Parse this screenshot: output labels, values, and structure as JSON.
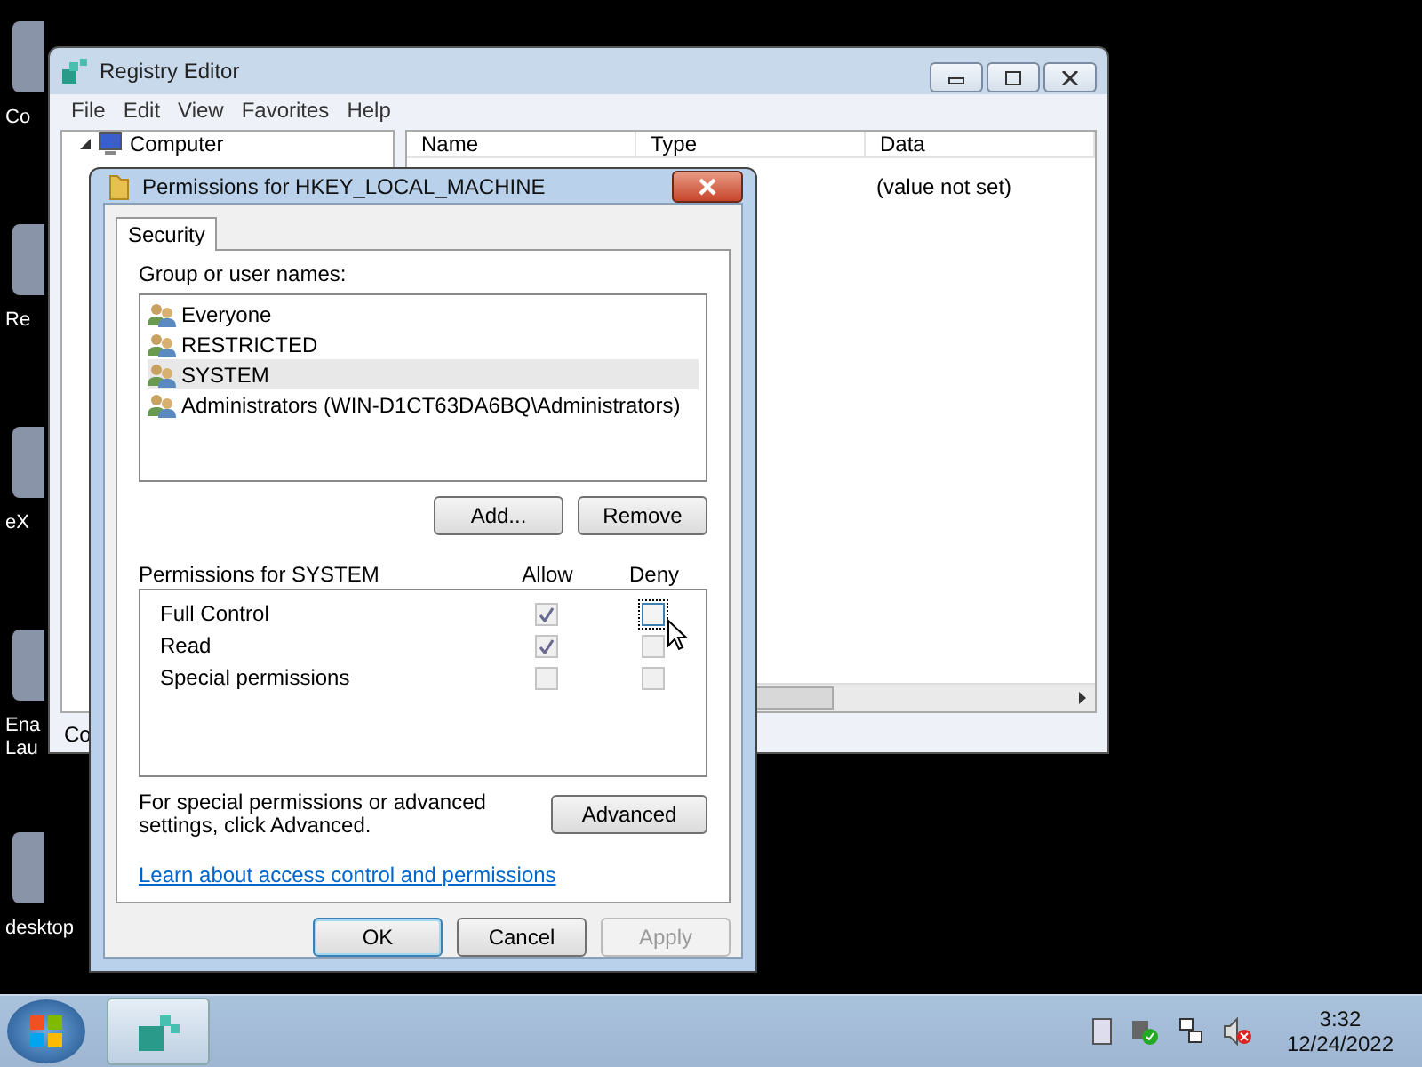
{
  "desktop_icons": [
    {
      "lines": [
        "Co"
      ]
    },
    {
      "lines": [
        "Re"
      ]
    },
    {
      "lines": [
        "eX"
      ]
    },
    {
      "lines": [
        "Ena",
        "Lau"
      ]
    },
    {
      "lines": [
        "desktop"
      ]
    }
  ],
  "registry": {
    "title": "Registry Editor",
    "menu": [
      "File",
      "Edit",
      "View",
      "Favorites",
      "Help"
    ],
    "tree": [
      {
        "label": "Computer",
        "expanded": true
      }
    ],
    "columns": [
      "Name",
      "Type",
      "Data"
    ],
    "rows": [
      {
        "data": "(value not set)"
      }
    ],
    "status_bar": "Co"
  },
  "dialog": {
    "title": "Permissions for HKEY_LOCAL_MACHINE",
    "tabs": [
      {
        "label": "Security",
        "selected": true
      }
    ],
    "group_label": "Group or user names:",
    "users": [
      {
        "name": "Everyone",
        "selected": false
      },
      {
        "name": "RESTRICTED",
        "selected": false
      },
      {
        "name": "SYSTEM",
        "selected": true
      },
      {
        "name": "Administrators (WIN-D1CT63DA6BQ\\Administrators)",
        "selected": false
      }
    ],
    "user_buttons": [
      "Add...",
      "Remove"
    ],
    "permissions_label": "Permissions for SYSTEM",
    "permission_columns": [
      "Allow",
      "Deny"
    ],
    "permissions": [
      {
        "name": "Full Control",
        "allow": {
          "checked": true,
          "disabled": true,
          "focused": false
        },
        "deny": {
          "checked": false,
          "disabled": false,
          "focused": true
        }
      },
      {
        "name": "Read",
        "allow": {
          "checked": true,
          "disabled": true,
          "focused": false
        },
        "deny": {
          "checked": false,
          "disabled": true,
          "focused": false
        }
      },
      {
        "name": "Special permissions",
        "allow": {
          "checked": false,
          "disabled": true,
          "focused": false
        },
        "deny": {
          "checked": false,
          "disabled": true,
          "focused": false
        }
      }
    ],
    "advanced_text": "For special permissions or advanced settings, click Advanced.",
    "advanced_button": "Advanced",
    "link": "Learn about access control and permissions",
    "buttons": [
      {
        "label": "OK",
        "default": true,
        "disabled": false
      },
      {
        "label": "Cancel",
        "default": false,
        "disabled": false
      },
      {
        "label": "Apply",
        "default": false,
        "disabled": true
      }
    ]
  },
  "taskbar": {
    "time": "3:32",
    "date": "12/24/2022"
  }
}
